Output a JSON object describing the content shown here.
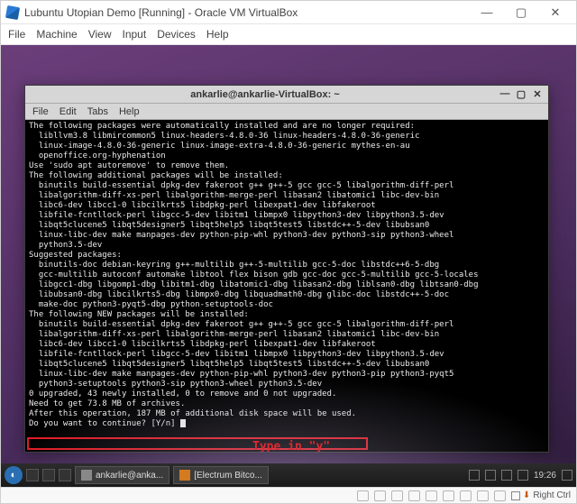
{
  "vb": {
    "title": "Lubuntu Utopian Demo [Running] - Oracle VM VirtualBox",
    "menu": [
      "File",
      "Machine",
      "View",
      "Input",
      "Devices",
      "Help"
    ],
    "status_hostkey": "Right Ctrl"
  },
  "terminal": {
    "title": "ankarlie@ankarlie-VirtualBox: ~",
    "menu": [
      "File",
      "Edit",
      "Tabs",
      "Help"
    ],
    "window_controls": {
      "min": "—",
      "max": "▢",
      "close": "✕"
    },
    "lines": [
      "The following packages were automatically installed and are no longer required:",
      "  libllvm3.8 libmircommon5 linux-headers-4.8.0-36 linux-headers-4.8.0-36-generic",
      "  linux-image-4.8.0-36-generic linux-image-extra-4.8.0-36-generic mythes-en-au",
      "  openoffice.org-hyphenation",
      "Use 'sudo apt autoremove' to remove them.",
      "The following additional packages will be installed:",
      "  binutils build-essential dpkg-dev fakeroot g++ g++-5 gcc gcc-5 libalgorithm-diff-perl",
      "  libalgorithm-diff-xs-perl libalgorithm-merge-perl libasan2 libatomic1 libc-dev-bin",
      "  libc6-dev libcc1-0 libcilkrts5 libdpkg-perl libexpat1-dev libfakeroot",
      "  libfile-fcntllock-perl libgcc-5-dev libitm1 libmpx0 libpython3-dev libpython3.5-dev",
      "  libqt5clucene5 libqt5designer5 libqt5help5 libqt5test5 libstdc++-5-dev libubsan0",
      "  linux-libc-dev make manpages-dev python-pip-whl python3-dev python3-sip python3-wheel",
      "  python3.5-dev",
      "Suggested packages:",
      "  binutils-doc debian-keyring g++-multilib g++-5-multilib gcc-5-doc libstdc++6-5-dbg",
      "  gcc-multilib autoconf automake libtool flex bison gdb gcc-doc gcc-5-multilib gcc-5-locales",
      "  libgcc1-dbg libgomp1-dbg libitm1-dbg libatomic1-dbg libasan2-dbg liblsan0-dbg libtsan0-dbg",
      "  libubsan0-dbg libcilkrts5-dbg libmpx0-dbg libquadmath0-dbg glibc-doc libstdc++-5-doc",
      "  make-doc python3-pyqt5-dbg python-setuptools-doc",
      "The following NEW packages will be installed:",
      "  binutils build-essential dpkg-dev fakeroot g++ g++-5 gcc gcc-5 libalgorithm-diff-perl",
      "  libalgorithm-diff-xs-perl libalgorithm-merge-perl libasan2 libatomic1 libc-dev-bin",
      "  libc6-dev libcc1-0 libcilkrts5 libdpkg-perl libexpat1-dev libfakeroot",
      "  libfile-fcntllock-perl libgcc-5-dev libitm1 libmpx0 libpython3-dev libpython3.5-dev",
      "  libqt5clucene5 libqt5designer5 libqt5help5 libqt5test5 libstdc++-5-dev libubsan0",
      "  linux-libc-dev make manpages-dev python-pip-whl python3-dev python3-pip python3-pyqt5",
      "  python3-setuptools python3-sip python3-wheel python3.5-dev",
      "0 upgraded, 43 newly installed, 0 to remove and 0 not upgraded.",
      "Need to get 73.8 MB of archives.",
      "After this operation, 187 MB of additional disk space will be used.",
      "Do you want to continue? [Y/n] "
    ],
    "annotation": "Type in \"y\""
  },
  "taskbar": {
    "items": [
      {
        "label": "ankarlie@anka..."
      },
      {
        "label": "[Electrum Bitco..."
      }
    ],
    "clock": "19:26"
  }
}
